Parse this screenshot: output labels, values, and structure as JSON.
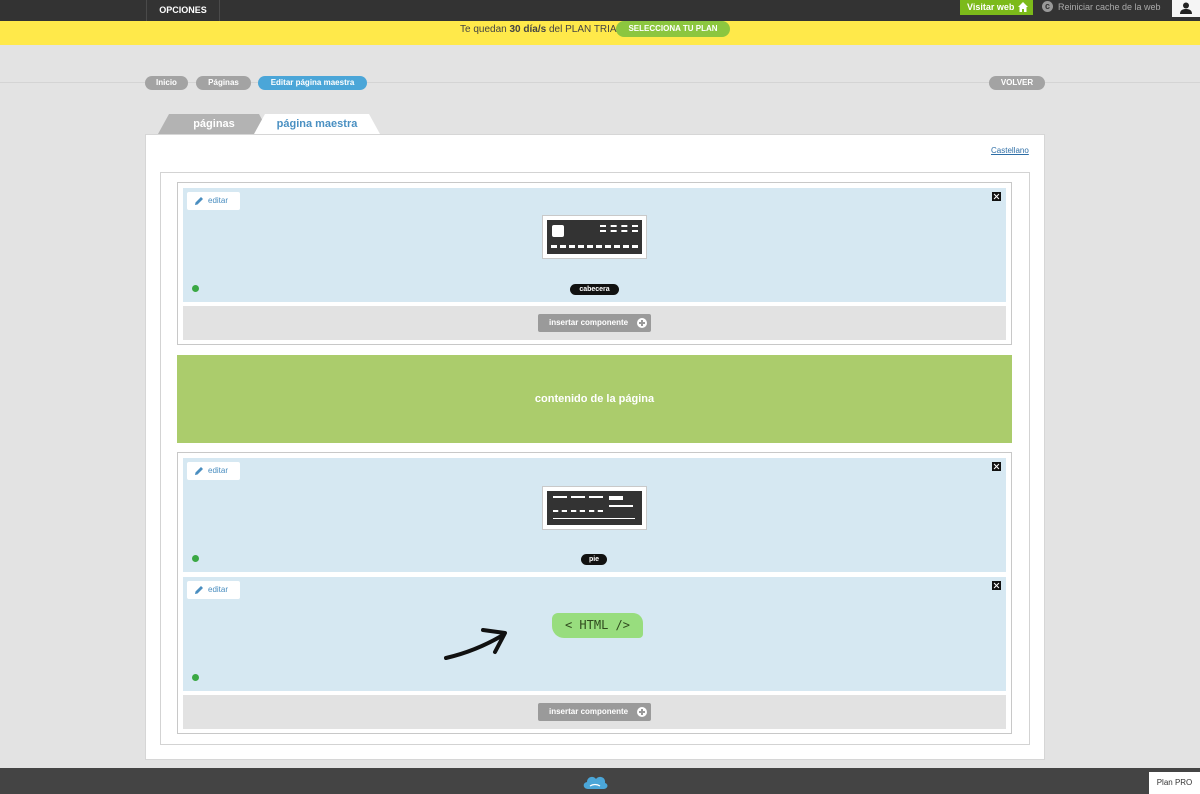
{
  "topbar": {
    "menu_label": "OPCIONES",
    "visit_label": "Visitar web",
    "reset_cache_label": "Reiniciar cache de la web"
  },
  "trial": {
    "prefix": "Te quedan",
    "days": "30 día/s",
    "suffix": "del PLAN TRIAL",
    "cta_label": "SELECCIONA TU PLAN"
  },
  "breadcrumb": [
    "Inicio",
    "Páginas",
    "Editar página maestra"
  ],
  "back_label": "VOLVER",
  "tabs": [
    "páginas",
    "página maestra"
  ],
  "language_link": "Castellano",
  "components": {
    "edit_label": "editar",
    "header_label": "cabecera",
    "footer_label": "pie",
    "html_label": "< HTML />",
    "insert_label": "insertar componente"
  },
  "content_zone_label": "contenido de la página",
  "footer": {
    "plan_label": "Plan PRO"
  },
  "colors": {
    "accent_blue": "#4ba6d8",
    "accent_green": "#7cba1a",
    "trial_yellow": "#ffe94a",
    "content_green": "#abcc6c",
    "status_green": "#3aa844"
  }
}
